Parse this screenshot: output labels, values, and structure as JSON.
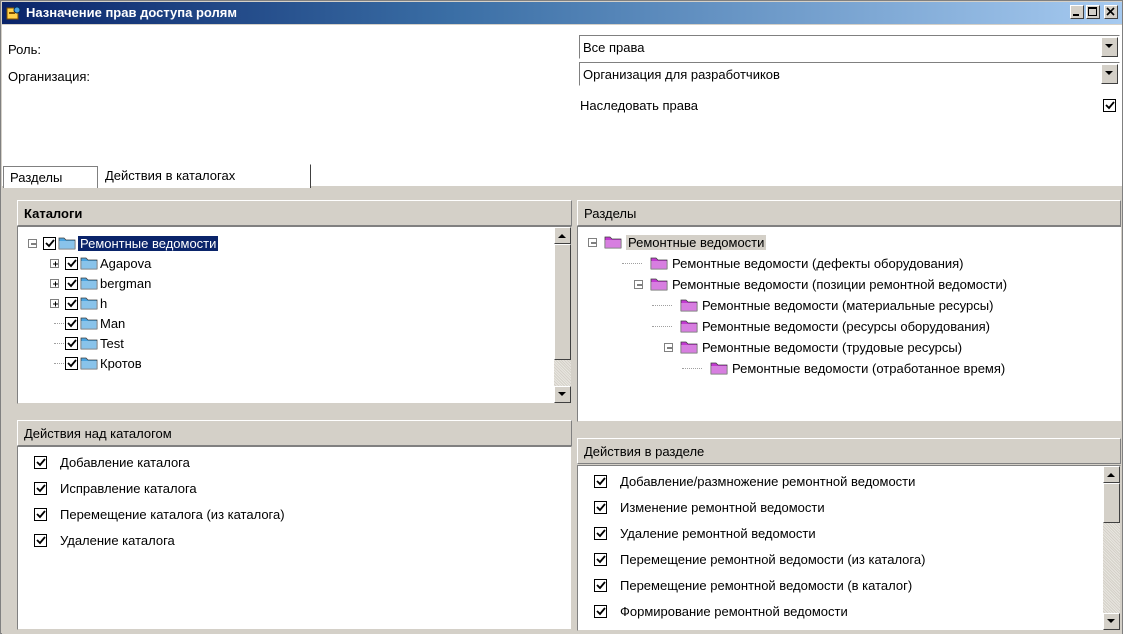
{
  "window": {
    "title": "Назначение прав доступа ролям",
    "controls": [
      "minimize",
      "maximize",
      "close"
    ]
  },
  "form": {
    "role_label": "Роль:",
    "role_value": "Все права",
    "org_label": "Организация:",
    "org_value": "Организация для разработчиков",
    "inherit_label": "Наследовать права",
    "inherit_checked": true
  },
  "tabs": [
    {
      "label": "Разделы",
      "active": false
    },
    {
      "label": "Действия в каталогах",
      "active": true
    }
  ],
  "catalogs": {
    "header": "Каталоги",
    "items": [
      {
        "label": "Ремонтные ведомости",
        "level": 0,
        "expander": "minus",
        "checked": true,
        "selected": true
      },
      {
        "label": "Agapova",
        "level": 1,
        "expander": "plus",
        "checked": true
      },
      {
        "label": "bergman",
        "level": 1,
        "expander": "plus",
        "checked": true
      },
      {
        "label": "h",
        "level": 1,
        "expander": "plus",
        "checked": true
      },
      {
        "label": "Man",
        "level": 1,
        "expander": "none",
        "checked": true
      },
      {
        "label": "Test",
        "level": 1,
        "expander": "none",
        "checked": true
      },
      {
        "label": "Кротов",
        "level": 1,
        "expander": "none",
        "checked": true
      }
    ]
  },
  "catalog_actions": {
    "header": "Действия над каталогом",
    "items": [
      {
        "label": "Добавление каталога",
        "checked": true
      },
      {
        "label": "Исправление каталога",
        "checked": true
      },
      {
        "label": "Перемещение каталога (из каталога)",
        "checked": true
      },
      {
        "label": "Удаление каталога",
        "checked": true
      }
    ]
  },
  "sections": {
    "header": "Разделы",
    "items": [
      {
        "label": "Ремонтные ведомости",
        "level": 0,
        "expander": "minus",
        "selected": true
      },
      {
        "label": "Ремонтные ведомости (дефекты оборудования)",
        "level": 1,
        "expander": "none"
      },
      {
        "label": "Ремонтные ведомости (позиции ремонтной ведомости)",
        "level": 1,
        "expander": "minus"
      },
      {
        "label": "Ремонтные ведомости (материальные ресурсы)",
        "level": 2,
        "expander": "none"
      },
      {
        "label": "Ремонтные ведомости (ресурсы оборудования)",
        "level": 2,
        "expander": "none"
      },
      {
        "label": "Ремонтные ведомости (трудовые ресурсы)",
        "level": 2,
        "expander": "minus"
      },
      {
        "label": "Ремонтные ведомости (отработанное время)",
        "level": 3,
        "expander": "none"
      }
    ]
  },
  "section_actions": {
    "header": "Действия в разделе",
    "items": [
      {
        "label": "Добавление/размножение ремонтной ведомости",
        "checked": true
      },
      {
        "label": "Изменение ремонтной ведомости",
        "checked": true
      },
      {
        "label": "Удаление ремонтной ведомости",
        "checked": true
      },
      {
        "label": "Перемещение ремонтной ведомости (из каталога)",
        "checked": true
      },
      {
        "label": "Перемещение ремонтной ведомости (в каталог)",
        "checked": true
      },
      {
        "label": "Формирование ремонтной ведомости",
        "checked": true
      }
    ]
  },
  "colors": {
    "title_start": "#0a246a",
    "title_end": "#a6caf0",
    "face": "#d4d0c8",
    "selection": "#0a246a",
    "folder_blue": "#4aa3df",
    "folder_magenta": "#c23ad0"
  },
  "icons": {
    "title": "key-permissions-icon",
    "catalog_folder": "folder-icon",
    "section_folder": "folder-magenta-icon"
  }
}
